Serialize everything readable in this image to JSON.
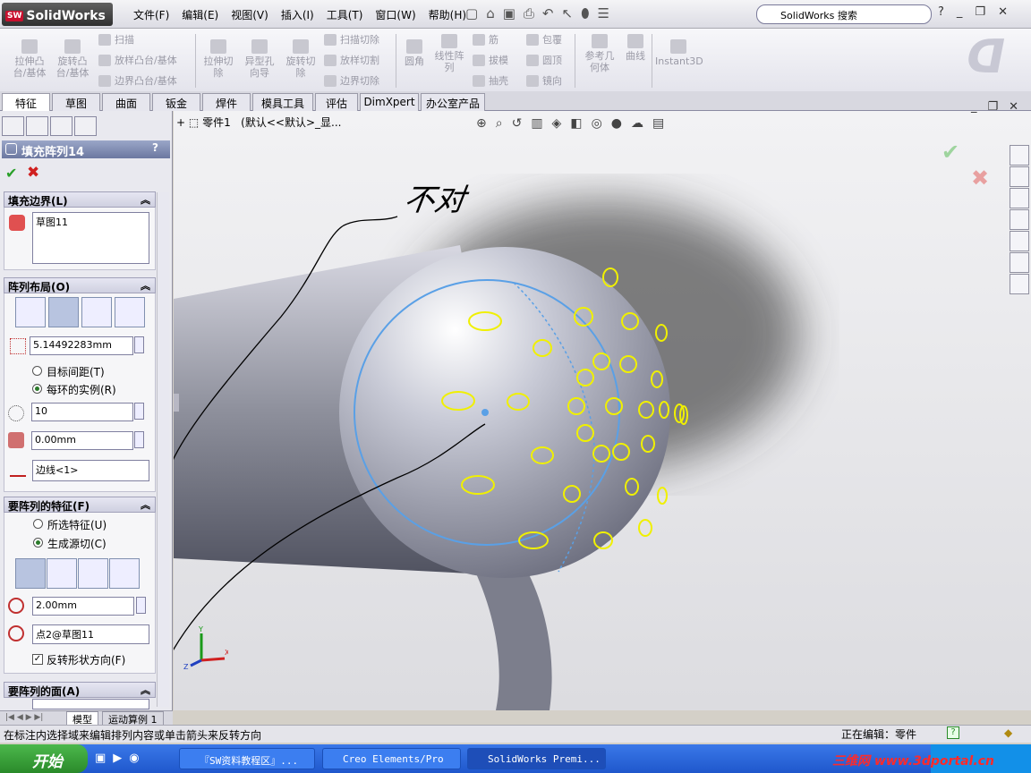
{
  "app": {
    "logo_text": "SolidWorks",
    "brand_badge": "SW"
  },
  "menu": [
    "文件(F)",
    "编辑(E)",
    "视图(V)",
    "插入(I)",
    "工具(T)",
    "窗口(W)",
    "帮助(H)"
  ],
  "search": {
    "value": "SolidWorks 搜索"
  },
  "toolbar": {
    "extrude": "拉伸凸\n台/基体",
    "revolve": "旋转凸\n台/基体",
    "sweep": "扫描",
    "loft": "放样凸台/基体",
    "boundary": "边界凸台/基体",
    "extrude_cut": "拉伸切\n除",
    "hole_wizard": "异型孔\n向导",
    "revolve_cut": "旋转切\n除",
    "swept_cut": "扫描切除",
    "lofted_cut": "放样切割",
    "boundary_cut": "边界切除",
    "fillet": "圆角",
    "linear_pattern": "线性阵\n列",
    "rib": "筋",
    "draft": "拔模",
    "shell": "抽壳",
    "wrap": "包覆",
    "dome": "圆顶",
    "mirror": "镜向",
    "ref_geom": "参考几\n何体",
    "curves": "曲线",
    "instant3d": "Instant3D"
  },
  "tabs": [
    "特征",
    "草图",
    "曲面",
    "钣金",
    "焊件",
    "模具工具",
    "评估",
    "DimXpert",
    "办公室产品"
  ],
  "panel": {
    "title": "填充阵列14",
    "help": "?",
    "fill_boundary": {
      "header": "填充边界(L)",
      "value": "草图11"
    },
    "layout": {
      "header": "阵列布局(O)",
      "spacing": "5.14492283mm",
      "radio_target": "目标间距(T)",
      "radio_per_ring": "每环的实例(R)",
      "instances": "10",
      "margin": "0.00mm",
      "direction": "边线<1>"
    },
    "features": {
      "header": "要阵列的特征(F)",
      "radio_selected": "所选特征(U)",
      "radio_create": "生成源切(C)",
      "diameter": "2.00mm",
      "vertex": "点2@草图11",
      "flip": "反转形状方向(F)"
    },
    "faces": {
      "header": "要阵列的面(A)"
    }
  },
  "viewport": {
    "tree_item": "零件1",
    "config": "(默认<<默认>_显...",
    "annotation": "不对"
  },
  "bottom_tabs": [
    "模型",
    "运动算例 1"
  ],
  "status": {
    "hint": "在标注内选择域来编辑排列内容或单击箭头来反转方向",
    "editing": "正在编辑：零件"
  },
  "taskbar": {
    "start": "开始",
    "items": [
      "『SW资料教程区』...",
      "Creo Elements/Pro",
      "SolidWorks Premi..."
    ],
    "watermark": "三维网 www.3dportal.cn"
  }
}
